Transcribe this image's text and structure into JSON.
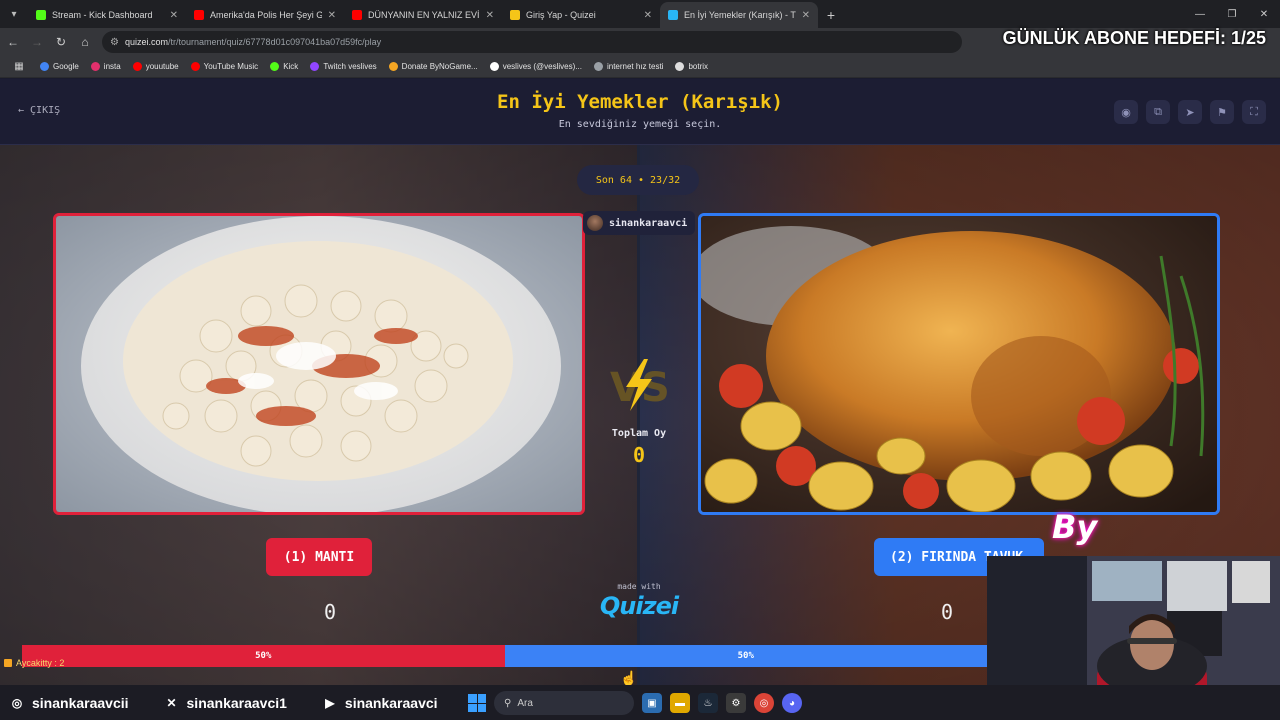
{
  "browser": {
    "tabs": [
      {
        "title": "Stream - Kick Dashboard",
        "color": "#53fc18",
        "active": false
      },
      {
        "title": "Amerika'da Polis Her Şeyi Görü",
        "color": "#ff0000",
        "active": false
      },
      {
        "title": "DÜNYANIN EN YALNIZ EVİNDE",
        "color": "#ff0000",
        "active": false
      },
      {
        "title": "Giriş Yap - Quizei",
        "color": "#f5c518",
        "active": false
      },
      {
        "title": "En İyi Yemekler (Karışık) - Tier Li",
        "color": "#29b6f6",
        "active": true
      }
    ],
    "url_host": "quizei.com",
    "url_path": "/tr/tournament/quiz/67778d01c097041ba07d59fc/play",
    "bookmarks": [
      {
        "label": "Google",
        "color": "#4285f4"
      },
      {
        "label": "insta",
        "color": "#e1306c"
      },
      {
        "label": "youutube",
        "color": "#ff0000"
      },
      {
        "label": "YouTube Music",
        "color": "#ff0000"
      },
      {
        "label": "Kick",
        "color": "#53fc18"
      },
      {
        "label": "Twitch veslives",
        "color": "#9146ff"
      },
      {
        "label": "Donate ByNoGame...",
        "color": "#f5a623"
      },
      {
        "label": "veslives (@veslives)...",
        "color": "#ffffff"
      },
      {
        "label": "internet hız testi",
        "color": "#9aa0a6"
      },
      {
        "label": "botrix",
        "color": "#dddddd"
      }
    ]
  },
  "overlay": {
    "goal": "GÜNLÜK ABONE HEDEFİ: 1/25",
    "by_badge": "By",
    "chat": "Aycakitty : 2"
  },
  "header": {
    "exit_label": "ÇIKIŞ",
    "title": "En İyi Yemekler (Karışık)",
    "subtitle": "En sevdiğiniz yemeği seçin."
  },
  "match": {
    "round": "Son 64 • 23/32",
    "streamer": "sinankaraavci",
    "total_label": "Toplam Oy",
    "total_votes": "0",
    "left": {
      "label": "(1) MANTI",
      "votes": "0",
      "percent": "50%",
      "accent": "#e0213a"
    },
    "right": {
      "label": "(2) FIRINDA TAVUK",
      "votes": "0",
      "percent": "50%",
      "accent": "#2f7bf5"
    },
    "split_left_fraction": 0.5,
    "made_with": "made with",
    "brand": "Quizei"
  },
  "social": [
    {
      "icon": "instagram-icon",
      "handle": "sinankaraavcii"
    },
    {
      "icon": "x-icon",
      "handle": "sinankaraavci1"
    },
    {
      "icon": "youtube-icon",
      "handle": "sinankaraavci"
    }
  ],
  "taskbar": {
    "search_placeholder": "Ara"
  }
}
